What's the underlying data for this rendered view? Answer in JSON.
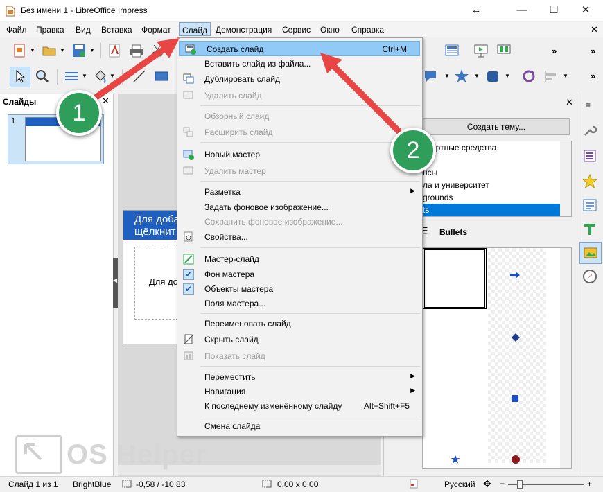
{
  "window": {
    "title": "Без имени 1 - LibreOffice Impress",
    "controls": [
      "↔",
      "—",
      "☐",
      "✕"
    ]
  },
  "menubar": {
    "items": [
      "Файл",
      "Правка",
      "Вид",
      "Вставка",
      "Формат",
      "Слайд",
      "Демонстрация",
      "Сервис",
      "Окно",
      "Справка"
    ],
    "active": "Слайд",
    "close_doc": "✕"
  },
  "slides_panel": {
    "title": "Слайды",
    "close": "✕",
    "slide_number": "1"
  },
  "slide_canvas": {
    "title_placeholder_line1": "Для доба",
    "title_placeholder_line2": "щёлкнит",
    "content_placeholder": "Для до"
  },
  "slide_menu": {
    "items": [
      {
        "label": "Создать слайд",
        "shortcut": "Ctrl+M",
        "highlighted": true,
        "icon": "new-slide-icon"
      },
      {
        "label": "Вставить слайд из файла...",
        "icon": ""
      },
      {
        "label": "Дублировать слайд",
        "icon": "duplicate-slide-icon"
      },
      {
        "label": "Удалить слайд",
        "disabled": true,
        "icon": "delete-slide-icon"
      },
      {
        "label": "Обзорный слайд",
        "disabled": true,
        "icon": ""
      },
      {
        "label": "Расширить слайд",
        "disabled": true,
        "icon": "expand-slide-icon"
      },
      {
        "label": "Новый мастер",
        "icon": "new-master-icon"
      },
      {
        "label": "Удалить мастер",
        "disabled": true,
        "icon": "delete-master-icon"
      },
      {
        "label": "Разметка",
        "submenu": true,
        "icon": ""
      },
      {
        "label": "Задать фоновое изображение...",
        "icon": ""
      },
      {
        "label": "Сохранить фоновое изображение...",
        "disabled": true,
        "icon": ""
      },
      {
        "label": "Свойства...",
        "icon": "properties-icon"
      },
      {
        "label": "Мастер-слайд",
        "icon": "master-slide-icon"
      },
      {
        "label": "Фон мастера",
        "checked": true,
        "icon": "check-icon"
      },
      {
        "label": "Объекты мастера",
        "checked": true,
        "icon": "check-icon"
      },
      {
        "label": "Поля мастера...",
        "icon": ""
      },
      {
        "label": "Переименовать слайд",
        "icon": ""
      },
      {
        "label": "Скрыть слайд",
        "icon": "hide-slide-icon"
      },
      {
        "label": "Показать слайд",
        "disabled": true,
        "icon": "show-slide-icon"
      },
      {
        "label": "Переместить",
        "submenu": true,
        "icon": ""
      },
      {
        "label": "Навигация",
        "submenu": true,
        "icon": ""
      },
      {
        "label": "К последнему изменённому слайду",
        "shortcut": "Alt+Shift+F5",
        "icon": ""
      },
      {
        "label": "Смена слайда",
        "icon": ""
      }
    ]
  },
  "gallery_panel": {
    "create_theme_button": "Создать тему...",
    "themes": [
      "ортные средства",
      "ы",
      "нсы",
      "ла и университет",
      "grounds",
      "ts"
    ],
    "selected_theme": "ts",
    "view_title": "Bullets"
  },
  "callouts": {
    "one": "1",
    "two": "2"
  },
  "watermark": "OS Helper",
  "statusbar": {
    "slide": "Слайд 1 из 1",
    "master": "BrightBlue",
    "position": "-0,58 / -10,83",
    "size": "0,00 x 0,00",
    "language": "Русский"
  },
  "colors": {
    "accent_highlight": "#91c9f7",
    "callout_green": "#2e9e5a",
    "arrow_red": "#e84545",
    "slide_title_blue": "#1f5fbf"
  }
}
